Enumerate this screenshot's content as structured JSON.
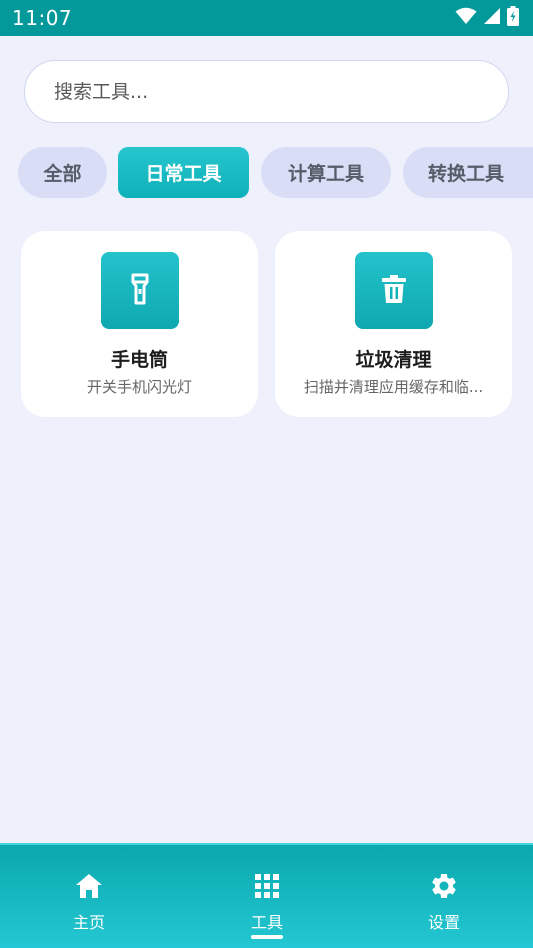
{
  "status_bar": {
    "time": "11:07"
  },
  "search": {
    "placeholder": "搜索工具..."
  },
  "categories": [
    {
      "label": "全部",
      "active": false
    },
    {
      "label": "日常工具",
      "active": true
    },
    {
      "label": "计算工具",
      "active": false
    },
    {
      "label": "转换工具",
      "active": false
    }
  ],
  "tools": [
    {
      "title": "手电筒",
      "description": "开关手机闪光灯",
      "icon": "flashlight-icon"
    },
    {
      "title": "垃圾清理",
      "description": "扫描并清理应用缓存和临...",
      "icon": "trash-icon"
    }
  ],
  "bottom_nav": [
    {
      "label": "主页",
      "icon": "home-icon",
      "active": false
    },
    {
      "label": "工具",
      "icon": "grid-icon",
      "active": true
    },
    {
      "label": "设置",
      "icon": "gear-icon",
      "active": false
    }
  ],
  "colors": {
    "accent": "#14b3bb",
    "status_bar": "#03999b",
    "background": "#eef1fc",
    "chip_inactive": "#d9ddf6"
  }
}
